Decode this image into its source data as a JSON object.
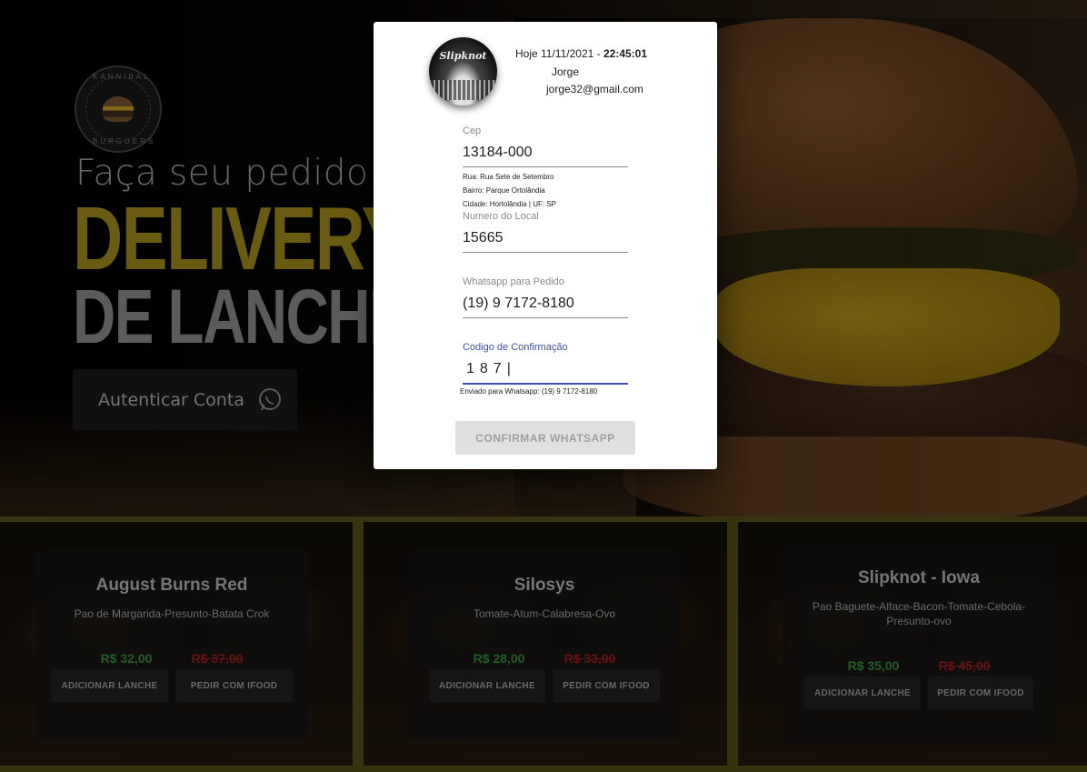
{
  "hero": {
    "tagline": "Faça seu pedido onli",
    "headline_1": "DELIVERY",
    "headline_2": "DE LANCHES",
    "auth_button": "Autenticar Conta",
    "logo_text_top": "KANNIBAL",
    "logo_text_bottom": "BURGUERS"
  },
  "modal": {
    "avatar_label": "Slipknot",
    "date_prefix": "Hoje 11/11/2021 - ",
    "time": "22:45:01",
    "user_name": "Jorge",
    "user_email": "jorge32@gmail.com",
    "cep": {
      "label": "Cep",
      "value": "13184-000"
    },
    "address": {
      "rua": "Rua: Rua Sete de Setembro",
      "bairro": "Bairro: Parque Ortolândia",
      "cidade": "Cidade: Hortolândia | UF: SP"
    },
    "numero": {
      "label": "Numero do Local",
      "value": "15665"
    },
    "whatsapp": {
      "label": "Whatsapp para Pedido",
      "value": "(19) 9 7172-8180"
    },
    "codigo": {
      "label": "Codigo de Confirmação",
      "value": "187|"
    },
    "sent_to": "Enviado para Whatsapp: (19) 9 7172-8180",
    "confirm_button": "CONFIRMAR WHATSAPP"
  },
  "products": [
    {
      "name": "August Burns Red",
      "desc": "Pao de Margarida-Presunto-Batata Crok",
      "price": "R$ 32,00",
      "old_price": "R$ 37,00",
      "add_label": "ADICIONAR LANCHE",
      "ifood_label": "PEDIR COM IFOOD"
    },
    {
      "name": "Silosys",
      "desc": "Tomate-Atum-Calabresa-Ovo",
      "price": "R$ 28,00",
      "old_price": "R$ 33,00",
      "add_label": "ADICIONAR LANCHE",
      "ifood_label": "PEDIR COM IFOOD"
    },
    {
      "name": "Slipknot - Iowa",
      "desc": "Pao Baguete-Alface-Bacon-Tomate-Cebola-Presunto-ovo",
      "price": "R$ 35,00",
      "old_price": "R$ 45,00",
      "add_label": "ADICIONAR LANCHE",
      "ifood_label": "PEDIR COM IFOOD"
    }
  ],
  "colors": {
    "accent_gold": "#8c7a18",
    "active_blue": "#3f51b5",
    "price_green": "#2e7d32",
    "price_red": "#8b1a1a"
  },
  "icons": {
    "auth": "whatsapp-icon"
  }
}
